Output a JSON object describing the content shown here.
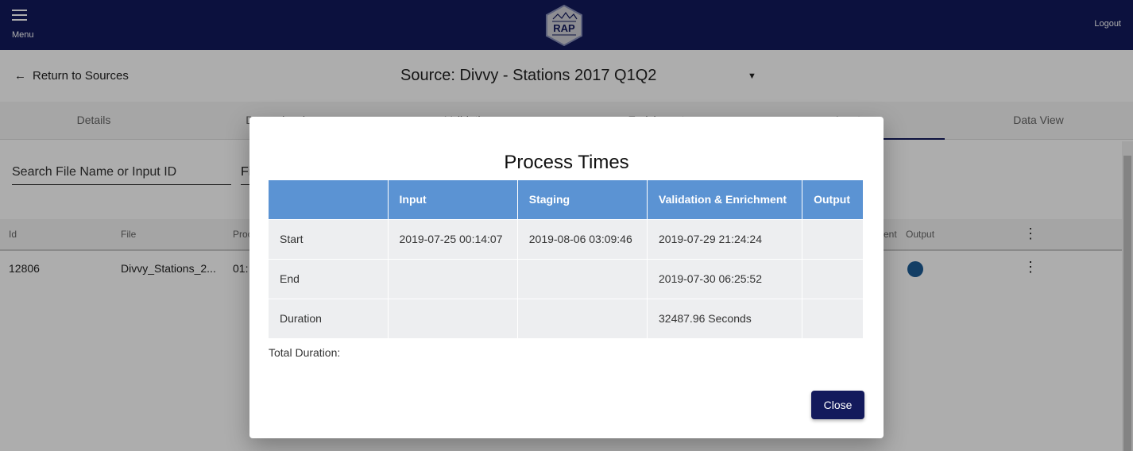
{
  "header": {
    "menu_label": "Menu",
    "logo_text": "RAP",
    "logout_label": "Logout"
  },
  "source": {
    "back_label": "Return to Sources",
    "title": "Source:  Divvy - Stations 2017 Q1Q2"
  },
  "tabs": [
    "Details",
    "Dependencies",
    "Validation",
    "Enrichment",
    "Inputs",
    "Data View"
  ],
  "active_tab": 4,
  "search": {
    "placeholder": "Search File Name or Input ID",
    "filter_placeholder": "Fi"
  },
  "table": {
    "headers": [
      "Id",
      "File",
      "Proc",
      "ent",
      "Output"
    ],
    "row": {
      "id": "12806",
      "file": "Divvy_Stations_2...",
      "proc": "01:"
    }
  },
  "modal": {
    "title": "Process Times",
    "columns": [
      "",
      "Input",
      "Staging",
      "Validation & Enrichment",
      "Output"
    ],
    "rows": [
      {
        "label": "Start",
        "cells": [
          "2019-07-25 00:14:07",
          "2019-08-06 03:09:46",
          "2019-07-29 21:24:24",
          ""
        ]
      },
      {
        "label": "End",
        "cells": [
          "",
          "",
          "2019-07-30 06:25:52",
          ""
        ]
      },
      {
        "label": "Duration",
        "cells": [
          "",
          "",
          "32487.96 Seconds",
          ""
        ]
      }
    ],
    "total_label": "Total Duration:",
    "close_label": "Close"
  },
  "colors": {
    "header": "#131a5c",
    "table_header": "#5b93d3",
    "button": "#131a5c"
  }
}
